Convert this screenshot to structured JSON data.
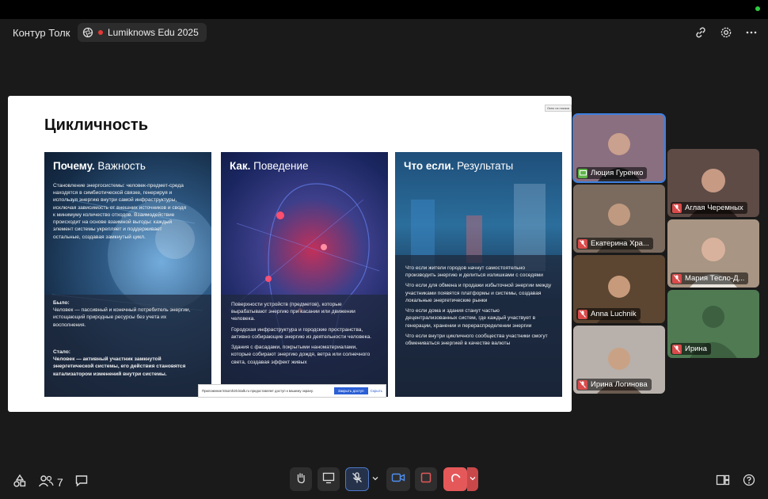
{
  "header": {
    "app_title": "Контур Толк",
    "room_name": "Lumiknows Edu 2025",
    "icons": [
      "link-icon",
      "gear-icon",
      "more-icon"
    ]
  },
  "slide": {
    "title": "Цикличность",
    "corner_button": "Окно из показа",
    "panels": [
      {
        "head_bold": "Почему.",
        "head_rest": " Важность",
        "top_text": "Становление энергосистемы: человек-предмет-среда находятся в симбиотической связке, генерируя и используя энергию внутри самой инфраструктуры, исключая зависимость от внешних источников и сводя к минимуму количество отходов. Взаимодействие происходит на основе взаимной выгоды: каждый элемент системы укрепляет и поддерживает остальные, создавая замкнутый цикл.",
        "before_label": "Было:",
        "before_text": "Человек — пассивный и конечный потребитель энергии, истощающий природные ресурсы без учета их восполнения.",
        "after_label": "Стало:",
        "after_text": "Человек — активный участник замкнутой энергетической системы, его действия становятся катализатором изменений внутри системы."
      },
      {
        "head_bold": "Как.",
        "head_rest": " Поведение",
        "paragraphs": [
          "Поверхности устройств (предметов), которые вырабатывают энергию при касании или движении человека.",
          "Городская инфраструктура и городские пространства, активно собирающие энергию из деятельности человека.",
          "Здания с фасадами, покрытыми наноматериалами, которые собирают энергию дождя, ветра или солнечного света, создавая эффект живых"
        ]
      },
      {
        "head_bold": "Что если.",
        "head_rest": " Результаты",
        "paragraphs": [
          "Что если жители городов начнут самостоятельно производить энергию и делиться излишками с соседями",
          "Что если для обмена и продажи избыточной энергии между участниками появятся платформы и системы, создавая локальные энергетические рынки",
          "Что если дома и здания станут частью децентрализованных систем, где каждый участвует в генерации, хранении и перераспределении энергии",
          "Что если внутри цикличного сообщества участники смогут обмениваться энергией в качестве валюты"
        ]
      }
    ],
    "share_bar": {
      "text": "Приложение ktsomh20.ktalk.ru предоставляет доступ к вашему экрану.",
      "stop": "Закрыть доступ",
      "hide": "Скрыть"
    }
  },
  "participants": [
    {
      "name": "Люция Гуренко",
      "status": "screen-share-icon",
      "active": true
    },
    {
      "name": "Аглая Черемных",
      "status": "mic-off-icon"
    },
    {
      "name": "Екатерина Хра...",
      "status": "mic-off-icon"
    },
    {
      "name": "Мария Тесло-Д...",
      "status": "mic-off-icon"
    },
    {
      "name": "Anna Luchnik",
      "status": "mic-off-icon"
    },
    {
      "name": "Ирина",
      "status": "mic-off-icon"
    },
    {
      "name": "Ирина Логинова",
      "status": "mic-off-icon"
    }
  ],
  "bottom": {
    "participant_count": "7",
    "colors": {
      "mic_off": "#d94b4b",
      "accent": "#3d7fe0",
      "hangup": "#e5585a"
    }
  }
}
